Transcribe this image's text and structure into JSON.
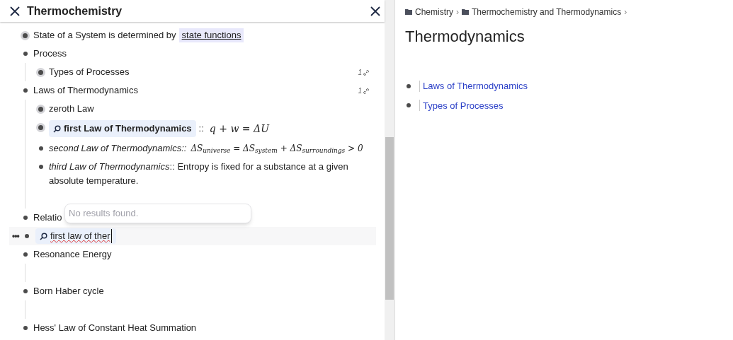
{
  "left_panel": {
    "title": "Thermochemistry",
    "outline": [
      {
        "kind": "link_text",
        "text": "State of a System is determined by",
        "link": "state functions",
        "collapsed": true
      },
      {
        "kind": "text",
        "text": "Process",
        "collapsed": false,
        "children": [
          {
            "kind": "text",
            "text": "Types of Processes",
            "collapsed": true,
            "ref_count": "1"
          }
        ]
      },
      {
        "kind": "text",
        "text": "Laws of Thermodynamics",
        "collapsed": false,
        "ref_count": "1",
        "children": [
          {
            "kind": "text",
            "text": "zeroth Law",
            "collapsed": true
          },
          {
            "kind": "embed",
            "text": "first Law of Thermodynamics",
            "separator": "::",
            "math": "q + w = ΔU",
            "collapsed": true
          },
          {
            "kind": "property",
            "key": "second Law of Thermodynamics",
            "separator": "::",
            "math": "ΔS$_{universe}$ = ΔS$_{system}$ + ΔS$_{surroundings}$ > 0",
            "collapsed": false
          },
          {
            "kind": "property",
            "key": "third Law of Thermodynamics",
            "separator": "::",
            "value": "Entropy is fixed for a substance at a given absolute temperature.",
            "collapsed": false
          },
          {
            "kind": "empty"
          }
        ]
      },
      {
        "kind": "text",
        "text": "Relatio",
        "collapsed": false
      },
      {
        "kind": "editing",
        "handle": "•••",
        "value": "first law of ther",
        "collapsed": false,
        "popup": "No results found."
      },
      {
        "kind": "text",
        "text": "Resonance Energy",
        "collapsed": false,
        "children": [
          {
            "kind": "empty"
          }
        ]
      },
      {
        "kind": "text",
        "text": "Born Haber cycle",
        "collapsed": false,
        "children": [
          {
            "kind": "empty"
          }
        ]
      },
      {
        "kind": "text",
        "text": "Hess' Law of Constant Heat Summation",
        "collapsed": false
      }
    ]
  },
  "right_panel": {
    "breadcrumb": [
      "Chemistry",
      "Thermochemistry and Thermodynamics"
    ],
    "breadcrumb_separator": "›",
    "title": "Thermodynamics",
    "links": [
      "Laws of Thermodynamics",
      "Types of Processes"
    ]
  }
}
